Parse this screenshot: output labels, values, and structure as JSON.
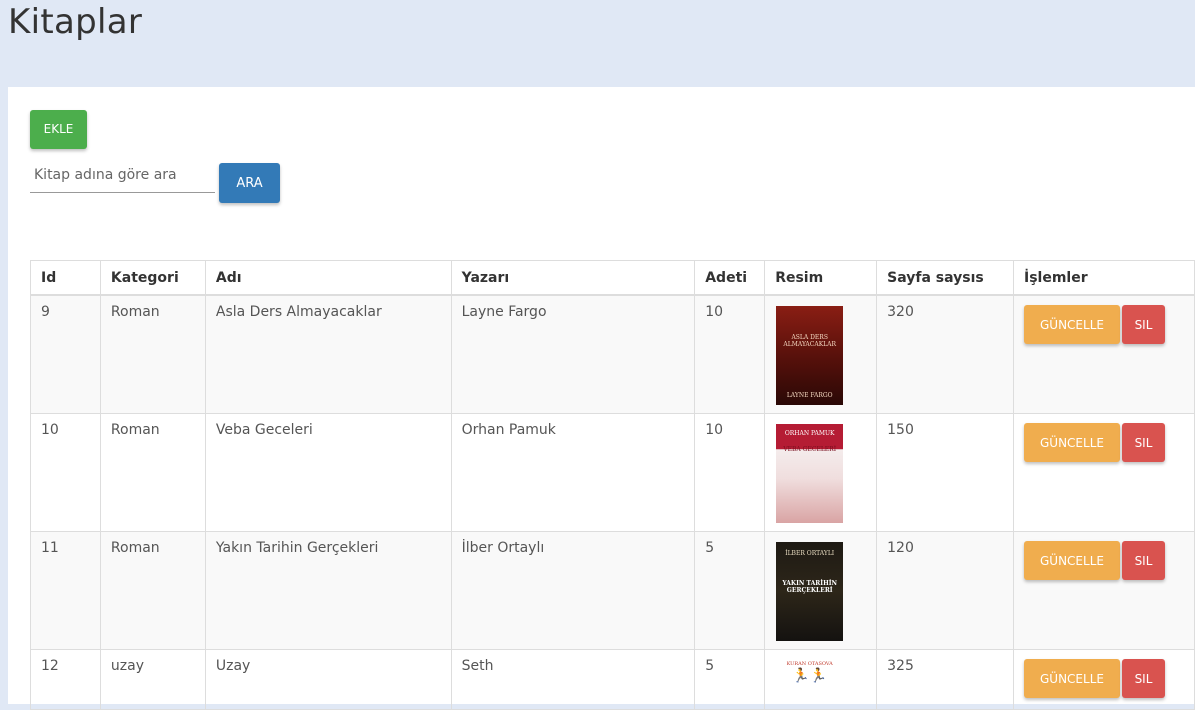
{
  "page": {
    "title": "Kitaplar"
  },
  "toolbar": {
    "add_label": "EKLE",
    "search_button_label": "ARA"
  },
  "search": {
    "placeholder": "Kitap adına göre ara",
    "value": ""
  },
  "table": {
    "headers": {
      "id": "Id",
      "category": "Kategori",
      "name": "Adı",
      "author": "Yazarı",
      "count": "Adeti",
      "image": "Resim",
      "pages": "Sayfa saysıs",
      "actions": "İşlemler"
    },
    "rows": [
      {
        "id": "9",
        "category": "Roman",
        "name": "Asla Ders Almayacaklar",
        "author": "Layne Fargo",
        "count": "10",
        "pages": "320",
        "cover": {
          "top": "ASLA DERS ALMAYACAKLAR",
          "bottom": "LAYNE FARGO"
        }
      },
      {
        "id": "10",
        "category": "Roman",
        "name": "Veba Geceleri",
        "author": "Orhan Pamuk",
        "count": "10",
        "pages": "150",
        "cover": {
          "top": "ORHAN PAMUK",
          "bottom": "VEBA GECELERİ"
        }
      },
      {
        "id": "11",
        "category": "Roman",
        "name": "Yakın Tarihin Gerçekleri",
        "author": "İlber Ortaylı",
        "count": "5",
        "pages": "120",
        "cover": {
          "top": "İLBER ORTAYLI",
          "bottom": "YAKIN TARİHİN GERÇEKLERİ"
        }
      },
      {
        "id": "12",
        "category": "uzay",
        "name": "Uzay",
        "author": "Seth",
        "count": "5",
        "pages": "325",
        "cover": {
          "top": "KURAN OTASOVA",
          "bottom": ""
        }
      }
    ],
    "update_label": "GÜNCELLE",
    "delete_label": "SIL"
  },
  "colors": {
    "page_bg": "#e0e8f5",
    "add": "#4cae4c",
    "search": "#337ab7",
    "update": "#f0ad4e",
    "delete": "#d9534f"
  }
}
